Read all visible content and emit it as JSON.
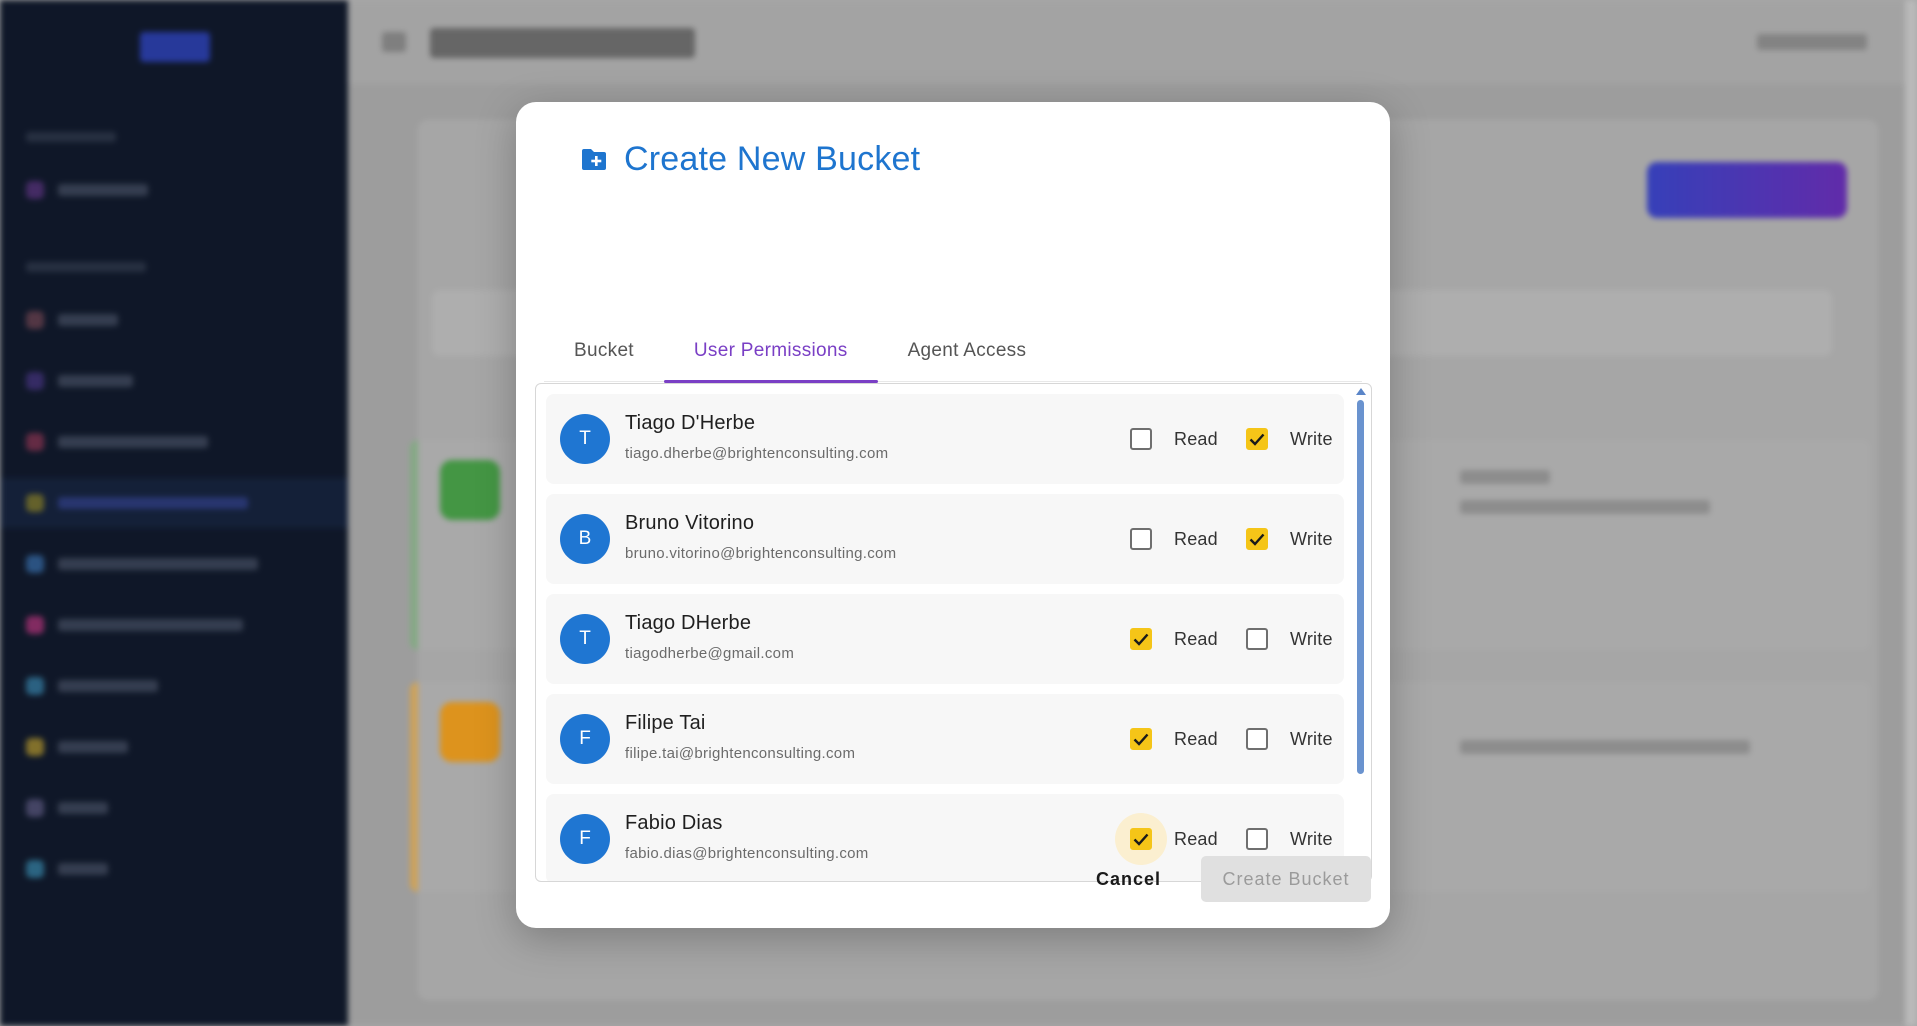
{
  "modal": {
    "title": "Create New Bucket",
    "icon": "folder-plus-icon",
    "tabs": [
      {
        "label": "Bucket",
        "active": false
      },
      {
        "label": "User Permissions",
        "active": true
      },
      {
        "label": "Agent Access",
        "active": false
      }
    ],
    "permission_labels": {
      "read": "Read",
      "write": "Write"
    },
    "users": [
      {
        "initial": "T",
        "name": "Tiago D'Herbe",
        "email": "tiago.dherbe@brightenconsulting.com",
        "read": false,
        "write": true
      },
      {
        "initial": "B",
        "name": "Bruno Vitorino",
        "email": "bruno.vitorino@brightenconsulting.com",
        "read": false,
        "write": true
      },
      {
        "initial": "T",
        "name": "Tiago DHerbe",
        "email": "tiagodherbe@gmail.com",
        "read": true,
        "write": false
      },
      {
        "initial": "F",
        "name": "Filipe Tai",
        "email": "filipe.tai@brightenconsulting.com",
        "read": true,
        "write": false
      },
      {
        "initial": "F",
        "name": "Fabio Dias",
        "email": "fabio.dias@brightenconsulting.com",
        "read": true,
        "write": false
      }
    ],
    "cancel_label": "Cancel",
    "create_label": "Create Bucket"
  },
  "colors": {
    "accent_blue": "#1e75cf",
    "tab_active": "#7a3fc5",
    "checkbox_checked": "#f5c518",
    "avatar": "#1f76d2"
  }
}
